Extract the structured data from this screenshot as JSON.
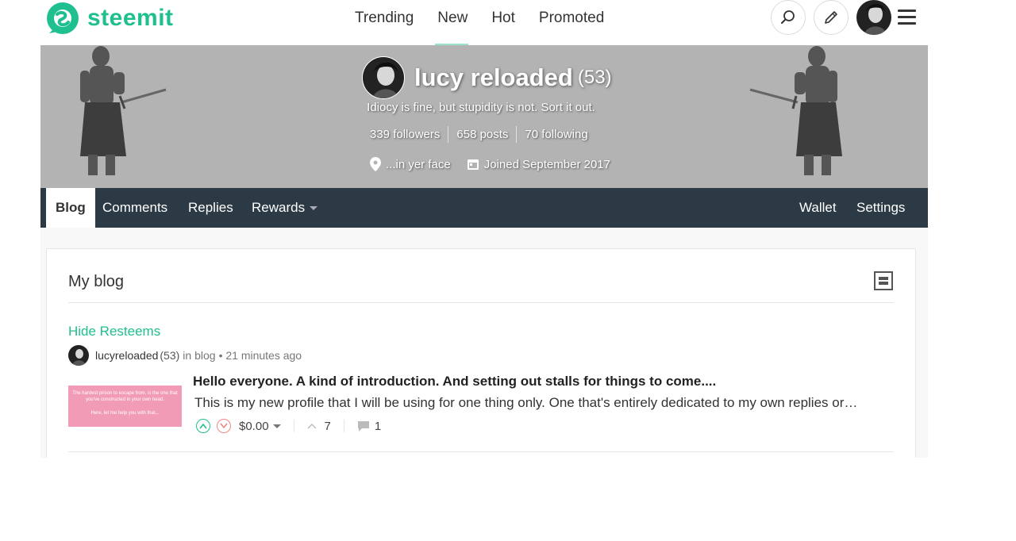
{
  "brand": {
    "name": "steemit",
    "color": "#1fbf8f"
  },
  "nav": {
    "items": [
      "Trending",
      "New",
      "Hot",
      "Promoted"
    ]
  },
  "header_icons": [
    "search-icon",
    "pencil-icon",
    "user-avatar",
    "hamburger-icon"
  ],
  "profile": {
    "name": "lucy reloaded",
    "reputation": "(53)",
    "about": "Idiocy is fine, but stupidity is not. Sort it out.",
    "followers": "339 followers",
    "posts": "658 posts",
    "following": "70 following",
    "location": "...in yer face",
    "joined": "Joined September 2017"
  },
  "tabs": {
    "blog": "Blog",
    "comments": "Comments",
    "replies": "Replies",
    "rewards": "Rewards",
    "wallet": "Wallet",
    "settings": "Settings"
  },
  "blog": {
    "title": "My blog",
    "hide_resteems": "Hide Resteems",
    "post": {
      "author": "lucyreloaded",
      "author_rep": "(53)",
      "category": "in blog",
      "time": "• 21 minutes ago",
      "title": "Hello everyone. A kind of introduction. And setting out stalls for things to come....",
      "body": "This is my new profile that I will be using for one thing only. One that's entirely dedicated to my own replies or…",
      "thumb_line1": "The hardest prison to escape from, is the one that you've constructed in your own head.",
      "thumb_line2": "Here, let me help you with that...",
      "payout": "$0.00",
      "votes": "7",
      "replies": "1"
    }
  },
  "colors": {
    "accent": "#1fbf8f",
    "tabbar": "#2c3a45",
    "cover": "#b3b3b3",
    "thumb": "#f29bb7"
  }
}
